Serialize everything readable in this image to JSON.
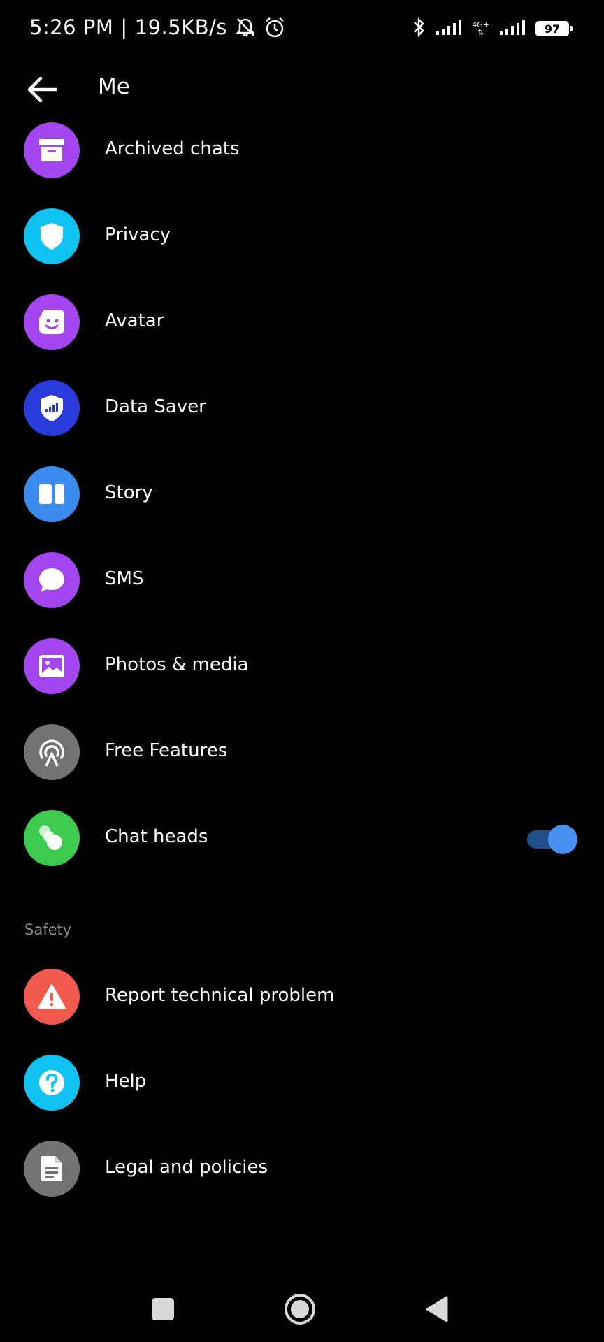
{
  "status_bar": {
    "time": "5:26 PM",
    "speed": "19.5KB/s",
    "network": "4G+",
    "battery": "97"
  },
  "header": {
    "title": "Me"
  },
  "items": [
    {
      "label": "Archived chats",
      "icon": "archive-icon",
      "color": "#A346F0"
    },
    {
      "label": "Privacy",
      "icon": "shield-icon",
      "color": "#0FC2F2"
    },
    {
      "label": "Avatar",
      "icon": "avatar-icon",
      "color": "#A346F0"
    },
    {
      "label": "Data Saver",
      "icon": "data-saver-icon",
      "color": "#2A3BDB"
    },
    {
      "label": "Story",
      "icon": "story-icon",
      "color": "#3C8CF0"
    },
    {
      "label": "SMS",
      "icon": "chat-bubble-icon",
      "color": "#A346F0"
    },
    {
      "label": "Photos & media",
      "icon": "photo-icon",
      "color": "#A346F0"
    },
    {
      "label": "Free Features",
      "icon": "broadcast-icon",
      "color": "#737373"
    },
    {
      "label": "Chat heads",
      "icon": "chat-heads-icon",
      "color": "#3CCB4F",
      "toggle_on": true
    }
  ],
  "safety": {
    "header": "Safety",
    "items": [
      {
        "label": "Report technical problem",
        "icon": "warning-icon",
        "color": "#F0594C"
      },
      {
        "label": "Help",
        "icon": "help-icon",
        "color": "#0FC2F2"
      },
      {
        "label": "Legal and policies",
        "icon": "document-icon",
        "color": "#737373"
      }
    ]
  }
}
